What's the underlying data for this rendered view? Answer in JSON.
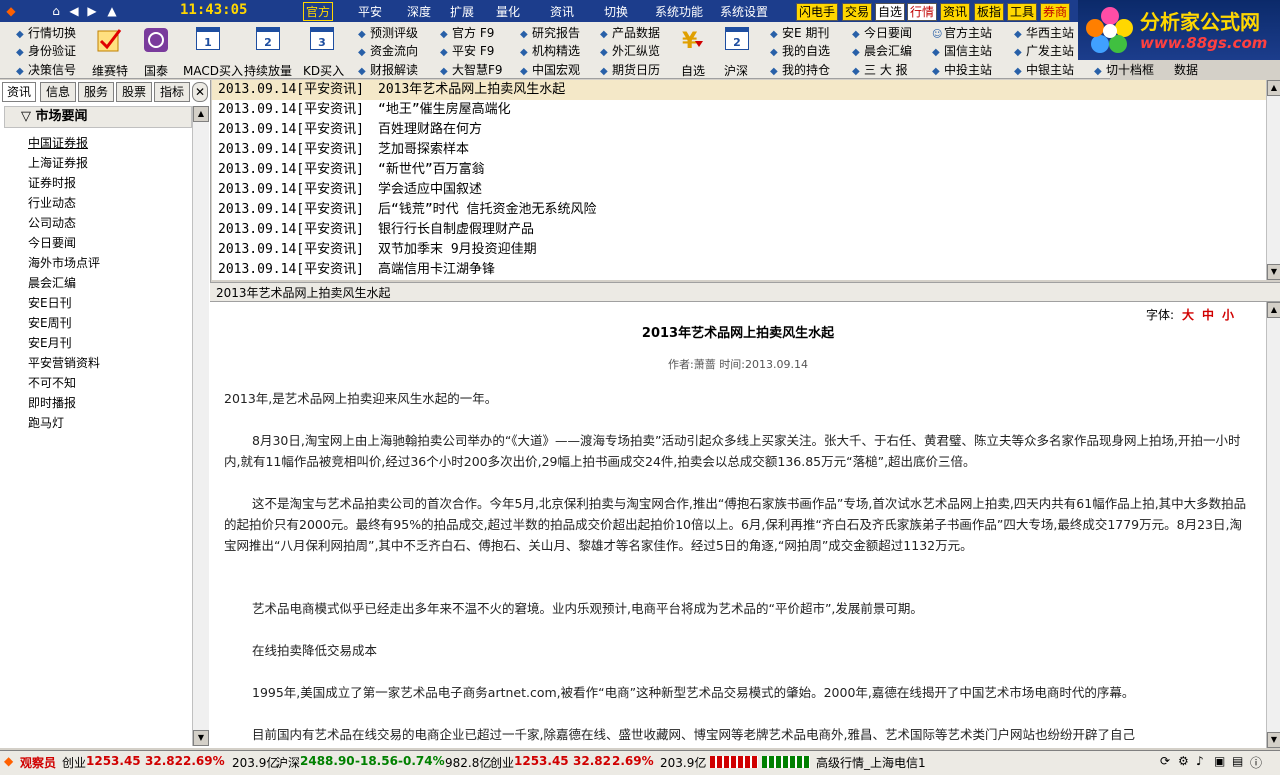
{
  "topbar": {
    "clock": "11:43:05",
    "menus": [
      "官方",
      "平安",
      "深度",
      "扩展",
      "量化",
      "资讯",
      "切换",
      "系统功能",
      "系统设置"
    ],
    "buttons": [
      "闪电手",
      "交易",
      "自选",
      "行情",
      "资讯",
      "板指",
      "工具",
      "券商"
    ]
  },
  "toolbar": {
    "col1": [
      "行情切换",
      "身份验证",
      "决策信号"
    ],
    "big": [
      "维赛特",
      "国泰",
      "MACD买入",
      "持续放量",
      "KD买入"
    ],
    "cal_nums": [
      "1",
      "2",
      "3"
    ],
    "col2": [
      "预测评级",
      "资金流向",
      "财报解读"
    ],
    "col3": [
      "官方  F9",
      "平安  F9",
      "大智慧F9"
    ],
    "col4": [
      "研究报告",
      "机构精选",
      "中国宏观"
    ],
    "col5": [
      "产品数据",
      "外汇纵览",
      "期货日历"
    ],
    "big2": [
      "自选",
      "沪深"
    ],
    "col6": [
      "安E 期刊",
      "我的自选",
      "我的持仓"
    ],
    "col7": [
      "今日要闻",
      "晨会汇编",
      "三  大  报"
    ],
    "col8": [
      "官方主站",
      "国信主站",
      "中投主站"
    ],
    "col9": [
      "华西主站",
      "广发主站",
      "中银主站"
    ],
    "col10": [
      "切十档框",
      "数据"
    ]
  },
  "logo": {
    "title": "分析家公式网",
    "url": "www.88gs.com"
  },
  "sidebar": {
    "tabs": [
      "资讯",
      "信息",
      "服务",
      "股票",
      "指标"
    ],
    "section": "市场要闻",
    "items": [
      "中国证券报",
      "上海证券报",
      "证券时报",
      "行业动态",
      "公司动态",
      "今日要闻",
      "海外市场点评",
      "晨会汇编",
      "安E日刊",
      "安E周刊",
      "安E月刊",
      "平安营销资料",
      "不可不知",
      "即时播报",
      "跑马灯"
    ]
  },
  "news": [
    {
      "date": "2013.09.14[平安资讯]",
      "title": "2013年艺术品网上拍卖风生水起"
    },
    {
      "date": "2013.09.14[平安资讯]",
      "title": "“地王”催生房屋高端化"
    },
    {
      "date": "2013.09.14[平安资讯]",
      "title": "百姓理财路在何方"
    },
    {
      "date": "2013.09.14[平安资讯]",
      "title": "芝加哥探索样本"
    },
    {
      "date": "2013.09.14[平安资讯]",
      "title": "“新世代”百万富翁"
    },
    {
      "date": "2013.09.14[平安资讯]",
      "title": "学会适应中国叙述"
    },
    {
      "date": "2013.09.14[平安资讯]",
      "title": "后“钱荒”时代 信托资金池无系统风险"
    },
    {
      "date": "2013.09.14[平安资讯]",
      "title": "银行行长自制虚假理财产品"
    },
    {
      "date": "2013.09.14[平安资讯]",
      "title": "双节加季末 9月投资迎佳期"
    },
    {
      "date": "2013.09.14[平安资讯]",
      "title": "高端信用卡江湖争锋"
    }
  ],
  "article": {
    "bar_title": "2013年艺术品网上拍卖风生水起",
    "font_label": "字体:",
    "font_sizes": [
      "大",
      "中",
      "小"
    ],
    "title": "2013年艺术品网上拍卖风生水起",
    "meta": "作者:萧蔷 时间:2013.09.14",
    "paragraphs": [
      "2013年,是艺术品网上拍卖迎来风生水起的一年。",
      "8月30日,淘宝网上由上海驰翰拍卖公司举办的“《大道》——渡海专场拍卖”活动引起众多线上买家关注。张大千、于右任、黄君璧、陈立夫等众多名家作品现身网上拍场,开拍一小时内,就有11幅作品被竞相叫价,经过36个小时200多次出价,29幅上拍书画成交24件,拍卖会以总成交额136.85万元“落槌”,超出底价三倍。",
      "这不是淘宝与艺术品拍卖公司的首次合作。今年5月,北京保利拍卖与淘宝网合作,推出“傅抱石家族书画作品”专场,首次试水艺术品网上拍卖,四天内共有61幅作品上拍,其中大多数拍品的起拍价只有2000元。最终有95%的拍品成交,超过半数的拍品成交价超出起拍价10倍以上。6月,保利再推“齐白石及齐氏家族弟子书画作品”四大专场,最终成交1779万元。8月23日,淘宝网推出“八月保利网拍周”,其中不乏齐白石、傅抱石、关山月、黎雄才等名家佳作。经过5日的角逐,“网拍周”成交金额超过1132万元。",
      "艺术品电商模式似乎已经走出多年来不温不火的窘境。业内乐观预计,电商平台将成为艺术品的“平价超市”,发展前景可期。",
      "在线拍卖降低交易成本",
      "1995年,美国成立了第一家艺术品电子商务artnet.com,被看作“电商”这种新型艺术品交易模式的肇始。2000年,嘉德在线揭开了中国艺术市场电商时代的序幕。",
      "目前国内有艺术品在线交易的电商企业已超过一千家,除嘉德在线、盛世收藏网、博宝网等老牌艺术品电商外,雅昌、艺术国际等艺术类门户网站也纷纷开辟了自己"
    ]
  },
  "status": {
    "role": "观察员",
    "idx1_name": "创业",
    "idx1_val": "1253.45",
    "idx1_chg": "32.82",
    "idx1_pct": "2.69%",
    "idx1_amt": "203.9亿",
    "idx2_name": "沪深",
    "idx2_val": "2488.90",
    "idx2_chg": "-18.56",
    "idx2_pct": "-0.74%",
    "idx2_amt": "982.8亿",
    "idx3_name": "创业",
    "idx3_val": "1253.45",
    "idx3_chg": "32.82",
    "idx3_pct": "2.69%",
    "idx3_amt": "203.9亿",
    "server": "高级行情_上海电信1"
  }
}
